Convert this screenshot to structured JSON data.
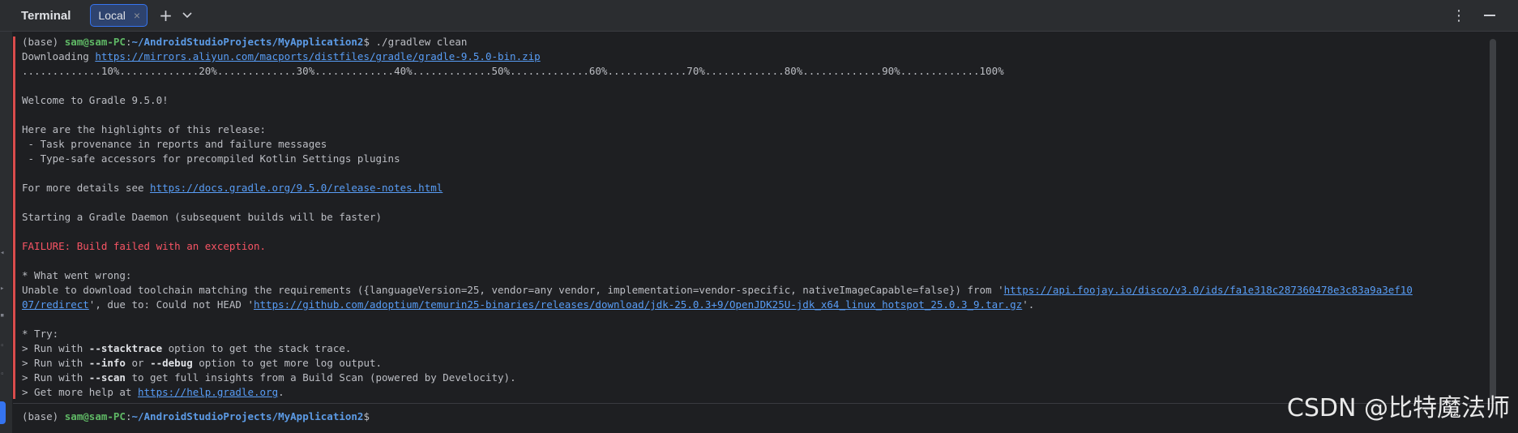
{
  "header": {
    "title": "Terminal",
    "tab_label": "Local",
    "tab_close": "×",
    "new_tab": "+",
    "more_options": "⋮"
  },
  "output": {
    "cmd_base": "(base) ",
    "cmd_user": "sam@sam-PC",
    "cmd_sep": ":",
    "cmd_path": "~/AndroidStudioProjects/MyApplication2",
    "cmd_suffix": "$ ./gradlew clean",
    "downloading": "Downloading ",
    "download_url": "https://mirrors.aliyun.com/macports/distfiles/gradle/gradle-9.5.0-bin.zip",
    "progress": ".............10%.............20%.............30%.............40%.............50%.............60%.............70%.............80%.............90%.............100%",
    "welcome": "Welcome to Gradle 9.5.0!",
    "highlights_heading": "Here are the highlights of this release:",
    "highlight_1": " - Task provenance in reports and failure messages",
    "highlight_2": " - Type-safe accessors for precompiled Kotlin Settings plugins",
    "details_prefix": "For more details see ",
    "details_url": "https://docs.gradle.org/9.5.0/release-notes.html",
    "daemon": "Starting a Gradle Daemon (subsequent builds will be faster)",
    "failure": "FAILURE: Build failed with an exception.",
    "went_wrong": "* What went wrong:",
    "error_1a": "Unable to download toolchain matching the requirements ({languageVersion=25, vendor=any vendor, implementation=vendor-specific, nativeImageCapable=false}) from '",
    "error_url_1a": "https://api.foojay.io/disco/v3.0/ids/fa1e318c287360478e3c83a9a3ef10",
    "error_url_1b": "07/redirect",
    "error_2b": "', due to: Could not HEAD '",
    "error_url_2": "https://github.com/adoptium/temurin25-binaries/releases/download/jdk-25.0.3+9/OpenJDK25U-jdk_x64_linux_hotspot_25.0.3_9.tar.gz",
    "error_2c": "'.",
    "try": "* Try:",
    "try1_a": "> Run with ",
    "try1_flag": "--stacktrace",
    "try1_b": " option to get the stack trace.",
    "try2_a": "> Run with ",
    "try2_flag1": "--info",
    "try2_mid": " or ",
    "try2_flag2": "--debug",
    "try2_b": " option to get more log output.",
    "try3_a": "> Run with ",
    "try3_flag": "--scan",
    "try3_b": " to get full insights from a Build Scan (powered by Develocity).",
    "try4_a": "> Get more help at ",
    "help_url": "https://help.gradle.org",
    "try4_b": "."
  },
  "prompt": {
    "base": "(base) ",
    "user": "sam@sam-PC",
    "sep": ":",
    "path": "~/AndroidStudioProjects/MyApplication2",
    "suffix": "$"
  },
  "watermark": "CSDN @比特魔法师",
  "colors": {
    "background": "#1e1f22",
    "toolbar": "#2b2d30",
    "accent": "#3574f0",
    "error": "#f75464",
    "link": "#589df6",
    "user_green": "#5fb865"
  },
  "icons": [
    "close-icon",
    "plus-icon",
    "chevron-down-icon",
    "more-options-icon",
    "minimize-icon"
  ]
}
